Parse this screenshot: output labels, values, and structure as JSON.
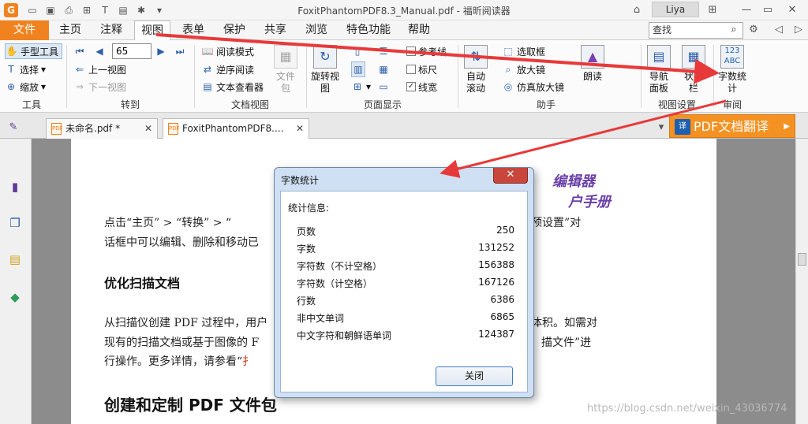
{
  "window": {
    "title": "FoxitPhantomPDF8.3_Manual.pdf - 福昕阅读器",
    "user": "Liya"
  },
  "menu": {
    "file": "文件",
    "items": [
      "主页",
      "注释",
      "视图",
      "表单",
      "保护",
      "共享",
      "浏览",
      "特色功能",
      "帮助"
    ],
    "active": "视图",
    "search_placeholder": "查找"
  },
  "ribbon": {
    "tools": {
      "hand": "手型工具",
      "select": "选择",
      "zoom": "缩放",
      "label": "工具"
    },
    "goto": {
      "page_number": "65",
      "prev_view": "上一视图",
      "next_view": "下一视图",
      "label": "转到"
    },
    "docview": {
      "read_mode": "阅读模式",
      "reverse_read": "逆序阅读",
      "text_viewer": "文本查看器",
      "file_pkg": "文件包",
      "label": "文档视图"
    },
    "pagedisplay": {
      "rotate": "旋转视图",
      "guides": "参考线",
      "ruler": "标尺",
      "lineweight": "线宽",
      "label": "页面显示"
    },
    "assist": {
      "auto_scroll": "自动滚动",
      "marquee": "选取框",
      "loupe": "放大镜",
      "magnifier": "仿真放大镜",
      "read": "朗读",
      "label": "助手"
    },
    "viewsettings": {
      "nav_panel": "导航面板",
      "status_bar": "状态栏",
      "label": "视图设置"
    },
    "review": {
      "word_count": "字数统计",
      "label": "审阅"
    }
  },
  "tabs": [
    {
      "label": "未命名.pdf *"
    },
    {
      "label": "FoxitPhantomPDF8...."
    }
  ],
  "translate_button": "PDF文档翻译",
  "document": {
    "brand_line1": "编辑器",
    "brand_line2": "户手册",
    "para1_line1": "点击“主页” > “转换” > “",
    "para1_line1_right": "预设置”对",
    "para1_line2": "话框中可以编辑、删除和移动已",
    "heading1": "优化扫描文档",
    "para2_line1": "从扫描仪创建 PDF 过程中，用户",
    "para2_line1_right": "体积。如需对",
    "para2_line2": "现有的扫描文档或基于图像的 F",
    "para2_line2_right": "描文件”进",
    "para2_line3": "行操作。更多详情，请参看“",
    "para2_line3_link": "扌",
    "heading2": "创建和定制 PDF 文件包"
  },
  "dialog": {
    "title": "字数统计",
    "heading": "统计信息:",
    "rows": [
      {
        "label": "页数",
        "value": "250"
      },
      {
        "label": "字数",
        "value": "131252"
      },
      {
        "label": "字符数（不计空格）",
        "value": "156388"
      },
      {
        "label": "字符数（计空格）",
        "value": "167126"
      },
      {
        "label": "行数",
        "value": "6386"
      },
      {
        "label": "非中文单词",
        "value": "6865"
      },
      {
        "label": "中文字符和朝鲜语单词",
        "value": "124387"
      }
    ],
    "close_button": "关闭"
  },
  "watermark": "https://blog.csdn.net/weixin_43036774",
  "colors": {
    "accent": "#f0831f",
    "arrow": "#e8393a",
    "brand_text": "#6a3fa8"
  }
}
